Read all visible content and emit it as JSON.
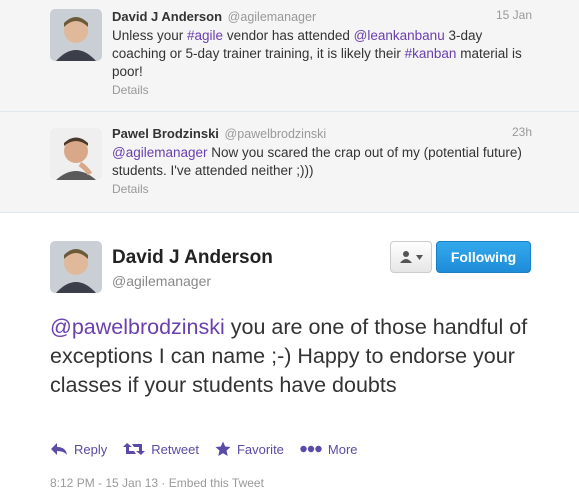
{
  "tweets": [
    {
      "fullname": "David J Anderson",
      "handle": "@agilemanager",
      "time": "15 Jan",
      "text_parts": [
        "Unless your ",
        "#agile",
        " vendor has attended ",
        "@leankanbanu",
        " 3-day coaching or 5-day trainer training, it is likely their ",
        "#kanban",
        " material is poor!"
      ],
      "details": "Details"
    },
    {
      "fullname": "Pawel Brodzinski",
      "handle": "@pawelbrodzinski",
      "time": "23h",
      "text_parts": [
        "@agilemanager",
        " Now you scared the crap out of my (potential future) students. I've attended neither ;)))"
      ],
      "details": "Details"
    }
  ],
  "main": {
    "fullname": "David J Anderson",
    "handle": "@agilemanager",
    "follow_label": "Following",
    "text_parts": [
      "@pawelbrodzinski",
      " you are one of those handful of exceptions I can name ;-) Happy to endorse your classes if your students have doubts"
    ],
    "actions": {
      "reply": "Reply",
      "retweet": "Retweet",
      "favorite": "Favorite",
      "more": "More"
    },
    "timestamp": "8:12 PM - 15 Jan 13",
    "embed": "Embed this Tweet"
  },
  "colors": {
    "link": "#6a3fae",
    "follow_button": "#2b9be6",
    "action": "#5b4aa6"
  }
}
